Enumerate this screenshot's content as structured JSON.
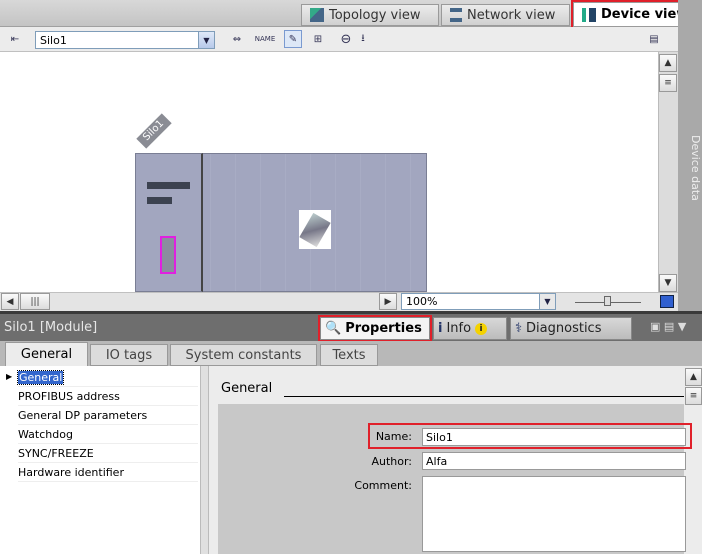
{
  "view_tabs": [
    {
      "label": "Topology view"
    },
    {
      "label": "Network view"
    },
    {
      "label": "Device view",
      "active": true
    }
  ],
  "toolbar": {
    "device_select": "Silo1"
  },
  "canvas": {
    "device_label": "Silo1",
    "zoom": "100%"
  },
  "side_panel": {
    "label": "Device data"
  },
  "properties": {
    "title": "Silo1 [Module]",
    "tabs": [
      {
        "label": "Properties",
        "active": true
      },
      {
        "label": "Info"
      },
      {
        "label": "Diagnostics"
      }
    ],
    "subtabs": [
      {
        "label": "General",
        "active": true
      },
      {
        "label": "IO tags"
      },
      {
        "label": "System constants"
      },
      {
        "label": "Texts"
      }
    ],
    "nav": [
      "General",
      "PROFIBUS address",
      "General DP parameters",
      "Watchdog",
      "SYNC/FREEZE",
      "Hardware identifier"
    ],
    "section_title": "General",
    "form": {
      "name_label": "Name:",
      "name_value": "Silo1",
      "author_label": "Author:",
      "author_value": "Alfa",
      "comment_label": "Comment:",
      "comment_value": ""
    }
  },
  "colors": {
    "highlight": "#e0202a",
    "module": "#a2a6bf",
    "selection": "#e020e0"
  }
}
